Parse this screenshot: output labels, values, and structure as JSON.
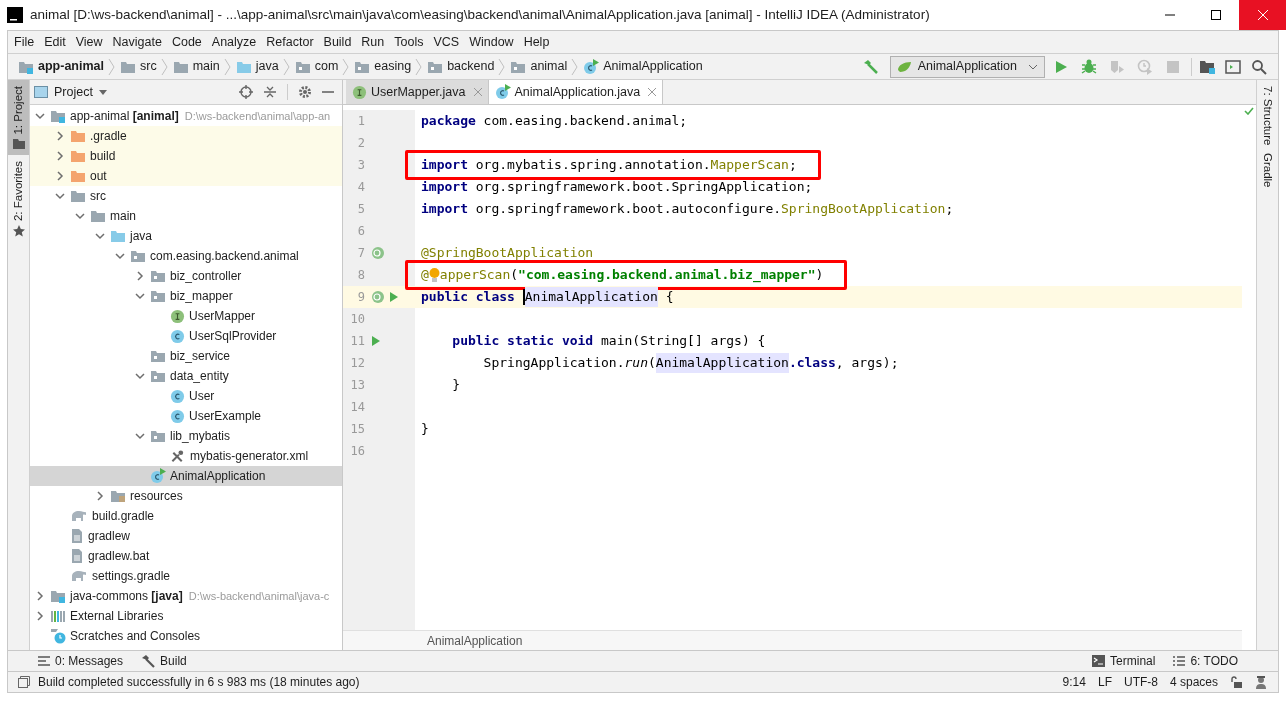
{
  "window": {
    "title": "animal [D:\\ws-backend\\animal] - ...\\app-animal\\src\\main\\java\\com\\easing\\backend\\animal\\AnimalApplication.java [animal] - IntelliJ IDEA (Administrator)"
  },
  "menu": [
    "File",
    "Edit",
    "View",
    "Navigate",
    "Code",
    "Analyze",
    "Refactor",
    "Build",
    "Run",
    "Tools",
    "VCS",
    "Window",
    "Help"
  ],
  "breadcrumb": [
    {
      "label": "app-animal",
      "kind": "module"
    },
    {
      "label": "src",
      "kind": "folder"
    },
    {
      "label": "main",
      "kind": "folder"
    },
    {
      "label": "java",
      "kind": "source-folder"
    },
    {
      "label": "com",
      "kind": "package"
    },
    {
      "label": "easing",
      "kind": "package"
    },
    {
      "label": "backend",
      "kind": "package"
    },
    {
      "label": "animal",
      "kind": "package"
    },
    {
      "label": "AnimalApplication",
      "kind": "app-class"
    }
  ],
  "run_config": "AnimalApplication",
  "toolbar": [
    {
      "kind": "run",
      "disabled": false
    },
    {
      "kind": "debug",
      "disabled": false
    },
    {
      "kind": "coverage",
      "disabled": true
    },
    {
      "kind": "profile",
      "disabled": true
    },
    {
      "kind": "stop",
      "disabled": true
    }
  ],
  "left_stripe": [
    {
      "label": "1: Project",
      "kind": "project",
      "selected": true
    },
    {
      "label": "2: Favorites",
      "kind": "favorites",
      "selected": false
    }
  ],
  "right_stripe": [
    {
      "label": "7: Structure"
    },
    {
      "label": "Gradle"
    }
  ],
  "project_panel": {
    "title": "Project",
    "tree": [
      {
        "label": "app-animal **[animal]**",
        "path": "D:\\ws-backend\\animal\\app-an",
        "kind": "module",
        "expanded": true,
        "selected": false,
        "excluded": false,
        "children": [
          {
            "label": ".gradle",
            "kind": "folder-excluded",
            "expanded": false,
            "selected": false,
            "excluded": true
          },
          {
            "label": "build",
            "kind": "folder-excluded",
            "expanded": false,
            "selected": false,
            "excluded": true
          },
          {
            "label": "out",
            "kind": "folder-excluded",
            "expanded": false,
            "selected": false,
            "excluded": true
          },
          {
            "label": "src",
            "kind": "folder",
            "expanded": true,
            "selected": false,
            "excluded": false,
            "children": [
              {
                "label": "main",
                "kind": "folder",
                "expanded": true,
                "selected": false,
                "excluded": false,
                "children": [
                  {
                    "label": "java",
                    "kind": "source-folder",
                    "expanded": true,
                    "selected": false,
                    "excluded": false,
                    "children": [
                      {
                        "label": "com.easing.backend.animal",
                        "kind": "package",
                        "expanded": true,
                        "selected": false,
                        "excluded": false,
                        "children": [
                          {
                            "label": "biz_controller",
                            "kind": "package",
                            "expanded": false,
                            "selected": false,
                            "excluded": false
                          },
                          {
                            "label": "biz_mapper",
                            "kind": "package",
                            "expanded": true,
                            "selected": false,
                            "excluded": false,
                            "children": [
                              {
                                "label": "UserMapper",
                                "kind": "interface",
                                "selected": false,
                                "excluded": false
                              },
                              {
                                "label": "UserSqlProvider",
                                "kind": "class",
                                "selected": false,
                                "excluded": false
                              }
                            ]
                          },
                          {
                            "label": "biz_service",
                            "kind": "package",
                            "selected": false,
                            "excluded": false
                          },
                          {
                            "label": "data_entity",
                            "kind": "package",
                            "expanded": true,
                            "selected": false,
                            "excluded": false,
                            "children": [
                              {
                                "label": "User",
                                "kind": "class",
                                "selected": false,
                                "excluded": false
                              },
                              {
                                "label": "UserExample",
                                "kind": "class",
                                "selected": false,
                                "excluded": false
                              }
                            ]
                          },
                          {
                            "label": "lib_mybatis",
                            "kind": "package",
                            "expanded": true,
                            "selected": false,
                            "excluded": false,
                            "children": [
                              {
                                "label": "mybatis-generator.xml",
                                "kind": "config",
                                "selected": false,
                                "excluded": false
                              }
                            ]
                          },
                          {
                            "label": "AnimalApplication",
                            "kind": "app-class",
                            "selected": true,
                            "excluded": false
                          }
                        ]
                      }
                    ]
                  },
                  {
                    "label": "resources",
                    "kind": "resources",
                    "expanded": false,
                    "selected": false,
                    "excluded": false
                  }
                ]
              }
            ]
          },
          {
            "label": "build.gradle",
            "kind": "gradle",
            "selected": false,
            "excluded": false
          },
          {
            "label": "gradlew",
            "kind": "file",
            "selected": false,
            "excluded": false
          },
          {
            "label": "gradlew.bat",
            "kind": "file",
            "selected": false,
            "excluded": false
          },
          {
            "label": "settings.gradle",
            "kind": "gradle",
            "selected": false,
            "excluded": false
          }
        ]
      },
      {
        "label": "java-commons **[java]**",
        "path": "D:\\ws-backend\\animal\\java-c",
        "kind": "module",
        "expanded": false,
        "selected": false,
        "excluded": false
      },
      {
        "label": "External Libraries",
        "kind": "libraries",
        "expanded": false,
        "selected": false,
        "excluded": false
      },
      {
        "label": "Scratches and Consoles",
        "kind": "scratches",
        "selected": false,
        "excluded": false
      }
    ]
  },
  "tabs": [
    {
      "label": "UserMapper.java",
      "kind": "interface",
      "selected": false
    },
    {
      "label": "AnimalApplication.java",
      "kind": "app-class",
      "selected": true
    }
  ],
  "editor": {
    "lines": [
      {
        "n": "1",
        "boxed": false,
        "current": false,
        "tokens": [
          {
            "text": "package",
            "kind": "kw"
          },
          {
            "text": " com.easing.backend.animal;",
            "kind": "plain"
          }
        ]
      },
      {
        "n": "2",
        "boxed": false,
        "current": false
      },
      {
        "n": "3",
        "boxed": true,
        "current": false,
        "tokens": [
          {
            "text": "import",
            "kind": "kw"
          },
          {
            "text": " org.mybatis.spring.annotation.",
            "kind": "plain"
          },
          {
            "text": "MapperScan",
            "kind": "ann"
          },
          {
            "text": ";",
            "kind": "plain"
          }
        ]
      },
      {
        "n": "4",
        "boxed": false,
        "current": false,
        "tokens": [
          {
            "text": "import",
            "kind": "kw"
          },
          {
            "text": " org.springframework.boot.SpringApplication;",
            "kind": "plain"
          }
        ]
      },
      {
        "n": "5",
        "boxed": false,
        "current": false,
        "tokens": [
          {
            "text": "import",
            "kind": "kw"
          },
          {
            "text": " org.springframework.boot.autoconfigure.",
            "kind": "plain"
          },
          {
            "text": "SpringBootApplication",
            "kind": "ann"
          },
          {
            "text": ";",
            "kind": "plain"
          }
        ]
      },
      {
        "n": "6",
        "boxed": false,
        "current": false
      },
      {
        "n": "7",
        "boxed": false,
        "current": false,
        "gutter_icons": [
          {
            "kind": "bean"
          }
        ],
        "tokens": [
          {
            "text": "@SpringBootApplication",
            "kind": "ann"
          }
        ]
      },
      {
        "n": "8",
        "boxed": true,
        "current": false,
        "tokens": [
          {
            "text": "@",
            "kind": "ann"
          },
          {
            "kind": "bulb"
          },
          {
            "text": "apperScan",
            "kind": "ann"
          },
          {
            "text": "(",
            "kind": "plain"
          },
          {
            "text": "\"com.easing.backend.animal.biz_mapper\"",
            "kind": "str"
          },
          {
            "text": ")",
            "kind": "plain"
          }
        ]
      },
      {
        "n": "9",
        "boxed": false,
        "current": true,
        "gutter_icons": [
          {
            "kind": "bean"
          },
          {
            "kind": "run"
          }
        ],
        "tokens": [
          {
            "text": "public class ",
            "kind": "kw"
          },
          {
            "kind": "caret"
          },
          {
            "text": "AnimalApplication",
            "kind": "ref"
          },
          {
            "text": " {",
            "kind": "plain"
          }
        ]
      },
      {
        "n": "10",
        "boxed": false,
        "current": false
      },
      {
        "n": "11",
        "boxed": false,
        "current": false,
        "gutter_icons": [
          {
            "kind": "run"
          }
        ],
        "tokens": [
          {
            "text": "    public static void ",
            "kind": "kw"
          },
          {
            "text": "main(String[] args) {",
            "kind": "plain"
          }
        ]
      },
      {
        "n": "12",
        "boxed": false,
        "current": false,
        "tokens": [
          {
            "text": "        SpringApplication.",
            "kind": "plain"
          },
          {
            "text": "run",
            "kind": "italic"
          },
          {
            "text": "(",
            "kind": "plain"
          },
          {
            "text": "AnimalApplication",
            "kind": "ref"
          },
          {
            "text": ".class",
            "kind": "kw"
          },
          {
            "text": ", args);",
            "kind": "plain"
          }
        ]
      },
      {
        "n": "13",
        "boxed": false,
        "current": false,
        "tokens": [
          {
            "text": "    }",
            "kind": "plain"
          }
        ]
      },
      {
        "n": "14",
        "boxed": false,
        "current": false
      },
      {
        "n": "15",
        "boxed": false,
        "current": false,
        "tokens": [
          {
            "text": "}",
            "kind": "plain"
          }
        ]
      },
      {
        "n": "16",
        "boxed": false,
        "current": false
      }
    ],
    "breadcrumb": "AnimalApplication"
  },
  "bottom_tools": {
    "left": [
      {
        "label": "0: Messages",
        "kind": "messages"
      },
      {
        "label": "Build",
        "kind": "hammer"
      }
    ],
    "right": [
      {
        "label": "Terminal",
        "kind": "terminal"
      },
      {
        "label": "6: TODO",
        "kind": "list"
      }
    ]
  },
  "status_bar": {
    "message": "Build completed successfully in 6 s 983 ms (18 minutes ago)",
    "position": "9:14",
    "line_separator": "LF",
    "encoding": "UTF-8",
    "indent": "4 spaces"
  }
}
